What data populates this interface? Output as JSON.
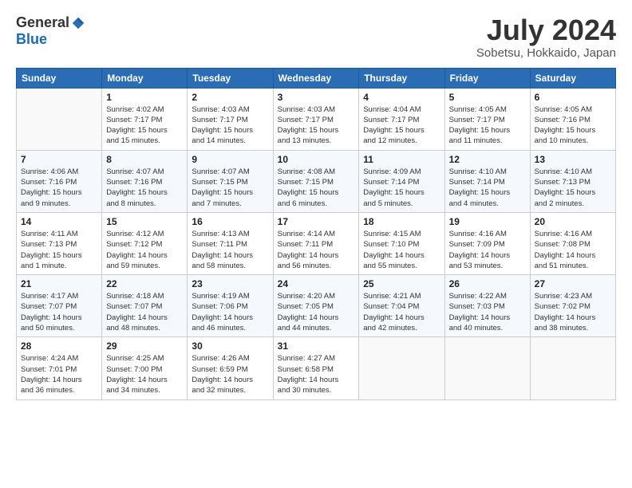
{
  "header": {
    "logo_general": "General",
    "logo_blue": "Blue",
    "month_title": "July 2024",
    "location": "Sobetsu, Hokkaido, Japan"
  },
  "columns": [
    "Sunday",
    "Monday",
    "Tuesday",
    "Wednesday",
    "Thursday",
    "Friday",
    "Saturday"
  ],
  "weeks": [
    [
      {
        "num": "",
        "info": ""
      },
      {
        "num": "1",
        "info": "Sunrise: 4:02 AM\nSunset: 7:17 PM\nDaylight: 15 hours\nand 15 minutes."
      },
      {
        "num": "2",
        "info": "Sunrise: 4:03 AM\nSunset: 7:17 PM\nDaylight: 15 hours\nand 14 minutes."
      },
      {
        "num": "3",
        "info": "Sunrise: 4:03 AM\nSunset: 7:17 PM\nDaylight: 15 hours\nand 13 minutes."
      },
      {
        "num": "4",
        "info": "Sunrise: 4:04 AM\nSunset: 7:17 PM\nDaylight: 15 hours\nand 12 minutes."
      },
      {
        "num": "5",
        "info": "Sunrise: 4:05 AM\nSunset: 7:17 PM\nDaylight: 15 hours\nand 11 minutes."
      },
      {
        "num": "6",
        "info": "Sunrise: 4:05 AM\nSunset: 7:16 PM\nDaylight: 15 hours\nand 10 minutes."
      }
    ],
    [
      {
        "num": "7",
        "info": "Sunrise: 4:06 AM\nSunset: 7:16 PM\nDaylight: 15 hours\nand 9 minutes."
      },
      {
        "num": "8",
        "info": "Sunrise: 4:07 AM\nSunset: 7:16 PM\nDaylight: 15 hours\nand 8 minutes."
      },
      {
        "num": "9",
        "info": "Sunrise: 4:07 AM\nSunset: 7:15 PM\nDaylight: 15 hours\nand 7 minutes."
      },
      {
        "num": "10",
        "info": "Sunrise: 4:08 AM\nSunset: 7:15 PM\nDaylight: 15 hours\nand 6 minutes."
      },
      {
        "num": "11",
        "info": "Sunrise: 4:09 AM\nSunset: 7:14 PM\nDaylight: 15 hours\nand 5 minutes."
      },
      {
        "num": "12",
        "info": "Sunrise: 4:10 AM\nSunset: 7:14 PM\nDaylight: 15 hours\nand 4 minutes."
      },
      {
        "num": "13",
        "info": "Sunrise: 4:10 AM\nSunset: 7:13 PM\nDaylight: 15 hours\nand 2 minutes."
      }
    ],
    [
      {
        "num": "14",
        "info": "Sunrise: 4:11 AM\nSunset: 7:13 PM\nDaylight: 15 hours\nand 1 minute."
      },
      {
        "num": "15",
        "info": "Sunrise: 4:12 AM\nSunset: 7:12 PM\nDaylight: 14 hours\nand 59 minutes."
      },
      {
        "num": "16",
        "info": "Sunrise: 4:13 AM\nSunset: 7:11 PM\nDaylight: 14 hours\nand 58 minutes."
      },
      {
        "num": "17",
        "info": "Sunrise: 4:14 AM\nSunset: 7:11 PM\nDaylight: 14 hours\nand 56 minutes."
      },
      {
        "num": "18",
        "info": "Sunrise: 4:15 AM\nSunset: 7:10 PM\nDaylight: 14 hours\nand 55 minutes."
      },
      {
        "num": "19",
        "info": "Sunrise: 4:16 AM\nSunset: 7:09 PM\nDaylight: 14 hours\nand 53 minutes."
      },
      {
        "num": "20",
        "info": "Sunrise: 4:16 AM\nSunset: 7:08 PM\nDaylight: 14 hours\nand 51 minutes."
      }
    ],
    [
      {
        "num": "21",
        "info": "Sunrise: 4:17 AM\nSunset: 7:07 PM\nDaylight: 14 hours\nand 50 minutes."
      },
      {
        "num": "22",
        "info": "Sunrise: 4:18 AM\nSunset: 7:07 PM\nDaylight: 14 hours\nand 48 minutes."
      },
      {
        "num": "23",
        "info": "Sunrise: 4:19 AM\nSunset: 7:06 PM\nDaylight: 14 hours\nand 46 minutes."
      },
      {
        "num": "24",
        "info": "Sunrise: 4:20 AM\nSunset: 7:05 PM\nDaylight: 14 hours\nand 44 minutes."
      },
      {
        "num": "25",
        "info": "Sunrise: 4:21 AM\nSunset: 7:04 PM\nDaylight: 14 hours\nand 42 minutes."
      },
      {
        "num": "26",
        "info": "Sunrise: 4:22 AM\nSunset: 7:03 PM\nDaylight: 14 hours\nand 40 minutes."
      },
      {
        "num": "27",
        "info": "Sunrise: 4:23 AM\nSunset: 7:02 PM\nDaylight: 14 hours\nand 38 minutes."
      }
    ],
    [
      {
        "num": "28",
        "info": "Sunrise: 4:24 AM\nSunset: 7:01 PM\nDaylight: 14 hours\nand 36 minutes."
      },
      {
        "num": "29",
        "info": "Sunrise: 4:25 AM\nSunset: 7:00 PM\nDaylight: 14 hours\nand 34 minutes."
      },
      {
        "num": "30",
        "info": "Sunrise: 4:26 AM\nSunset: 6:59 PM\nDaylight: 14 hours\nand 32 minutes."
      },
      {
        "num": "31",
        "info": "Sunrise: 4:27 AM\nSunset: 6:58 PM\nDaylight: 14 hours\nand 30 minutes."
      },
      {
        "num": "",
        "info": ""
      },
      {
        "num": "",
        "info": ""
      },
      {
        "num": "",
        "info": ""
      }
    ]
  ]
}
